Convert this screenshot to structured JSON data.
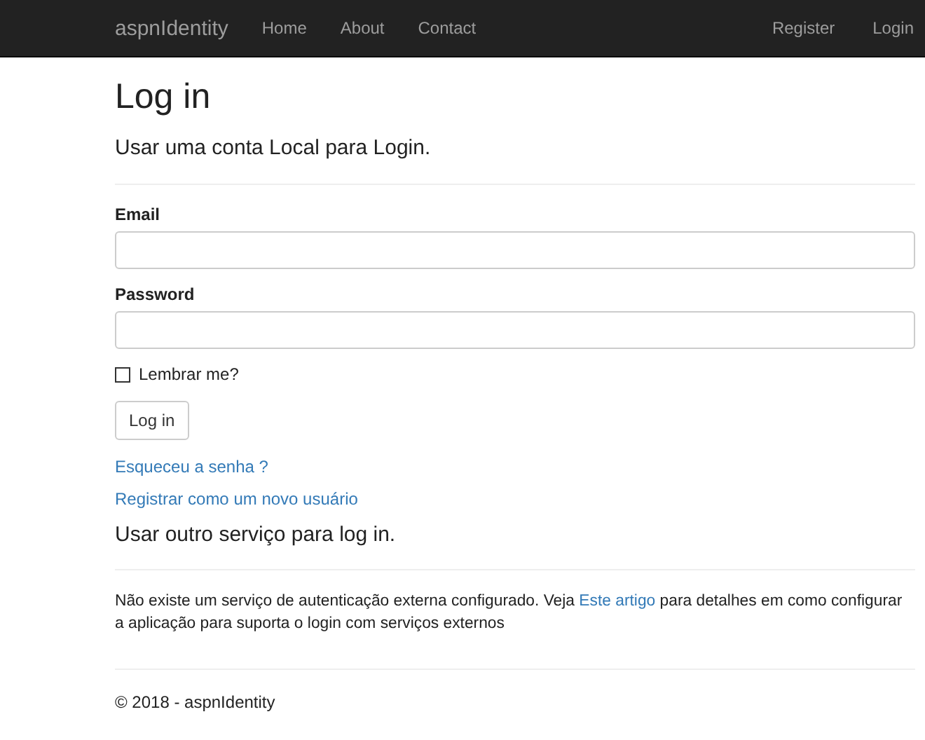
{
  "navbar": {
    "brand": "aspnIdentity",
    "left_links": [
      "Home",
      "About",
      "Contact"
    ],
    "right_links": [
      "Register",
      "Login"
    ]
  },
  "title": "Log in",
  "local_heading": "Usar uma conta Local para Login.",
  "fields": [
    {
      "label": "Email"
    },
    {
      "label": "Password"
    }
  ],
  "remember": {
    "label": "Lembrar me?",
    "checked": false
  },
  "submit": "Log in",
  "links": [
    "Esqueceu a senha ?",
    "Registrar como um novo usuário"
  ],
  "external_heading": "Usar outro serviço para log in.",
  "external_note": {
    "before": "Não existe um serviço de autenticação externa configurado. Veja ",
    "link": "Este artigo",
    "after": " para detalhes em como configurar a aplicação para suporta o login com serviços externos"
  },
  "footer": "© 2018 - aspnIdentity"
}
